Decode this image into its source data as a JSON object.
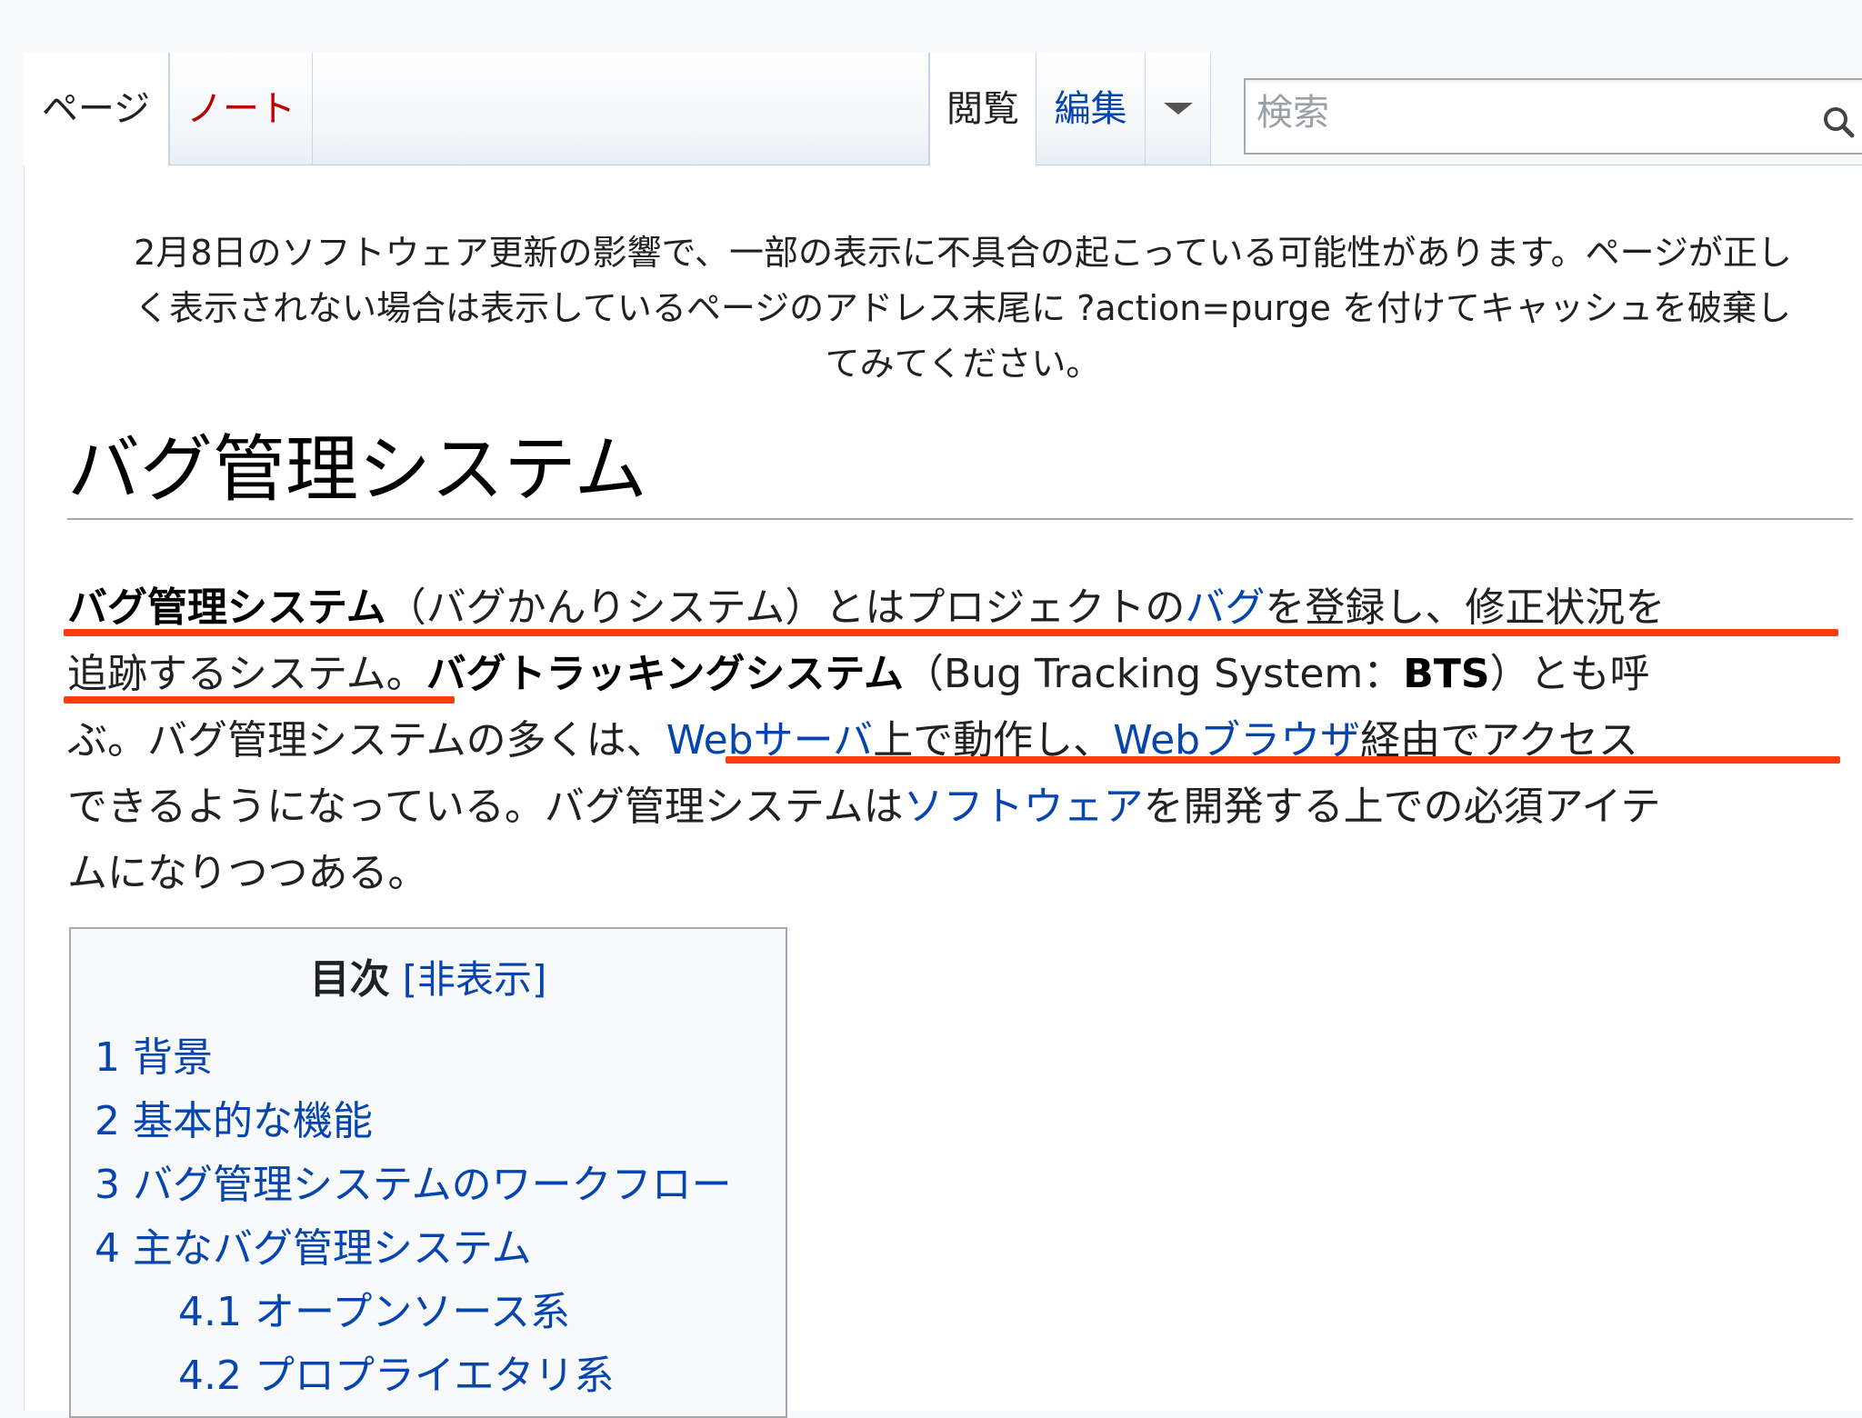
{
  "tabs": {
    "page": "ページ",
    "talk": "ノート",
    "read": "閲覧",
    "edit": "編集"
  },
  "search": {
    "placeholder": "検索"
  },
  "site_notice": {
    "line1": "2月8日のソフトウェア更新の影響で、一部の表示に不具合の起こっている可能性があります。ページが正し",
    "line2": "く表示されない場合は表示しているページのアドレス末尾に ?action=purge を付けてキャッシュを破棄し",
    "line3": "てみてください。"
  },
  "title": "バグ管理システム",
  "intro": {
    "t1_bold": "バグ管理システム",
    "t2": "（バグかんりシステム）とはプロジェクトの",
    "t3_link": "バグ",
    "t4": "を登録し、修正状況を",
    "t5": "追跡するシステム。",
    "t6_bold": "バグトラッキングシステム",
    "t7": "（Bug Tracking System：",
    "t8_bold": "BTS",
    "t9": "）とも呼",
    "t10": "ぶ。バグ管理システムの多くは、",
    "t11_link": "Webサーバ",
    "t12": "上で動作し、",
    "t13_link": "Webブラウザ",
    "t14": "経由でアクセス",
    "t15": "できるようになっている。バグ管理システムは",
    "t16_link": "ソフトウェア",
    "t17": "を開発する上での必須アイテ",
    "t18": "ムになりつつある。"
  },
  "toc": {
    "title": "目次",
    "toggle": "[非表示]",
    "items": [
      {
        "number": "1",
        "label": "背景"
      },
      {
        "number": "2",
        "label": "基本的な機能"
      },
      {
        "number": "3",
        "label": "バグ管理システムのワークフロー"
      },
      {
        "number": "4",
        "label": "主なバグ管理システム"
      },
      {
        "number": "4.1",
        "label": "オープンソース系"
      },
      {
        "number": "4.2",
        "label": "プロプライエタリ系"
      }
    ]
  },
  "colors": {
    "link": "#0645ad",
    "new_link": "#ba0000",
    "highlight": "#ff3b10"
  },
  "icons": [
    "dropdown-arrow-icon",
    "search-icon"
  ]
}
